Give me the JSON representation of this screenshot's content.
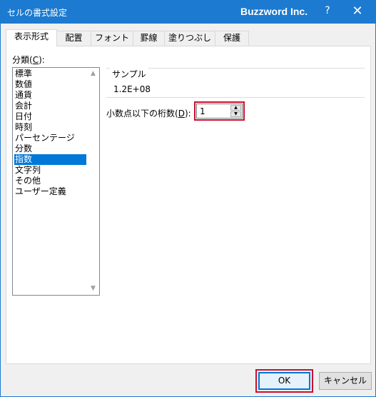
{
  "window": {
    "title": "セルの書式設定",
    "brand": "Buzzword Inc.",
    "help": "?",
    "close": "✕"
  },
  "tabs": [
    {
      "label": "表示形式",
      "active": true
    },
    {
      "label": "配置",
      "active": false
    },
    {
      "label": "フォント",
      "active": false
    },
    {
      "label": "罫線",
      "active": false
    },
    {
      "label": "塗りつぶし",
      "active": false
    },
    {
      "label": "保護",
      "active": false
    }
  ],
  "category": {
    "label_prefix": "分類(",
    "label_key": "C",
    "label_suffix": "):",
    "items": [
      "標準",
      "数値",
      "通貨",
      "会計",
      "日付",
      "時刻",
      "パーセンテージ",
      "分数",
      "指数",
      "文字列",
      "その他",
      "ユーザー定義"
    ],
    "selected": "指数"
  },
  "sample": {
    "legend": "サンプル",
    "value": "1.2E+08"
  },
  "decimal": {
    "label_prefix": "小数点以下の桁数(",
    "label_key": "D",
    "label_suffix": "):",
    "value": "1"
  },
  "buttons": {
    "ok": "OK",
    "cancel": "キャンセル"
  },
  "colors": {
    "titlebar": "#1c7ad0",
    "selection": "#0078d7",
    "highlight": "#c8102e"
  }
}
